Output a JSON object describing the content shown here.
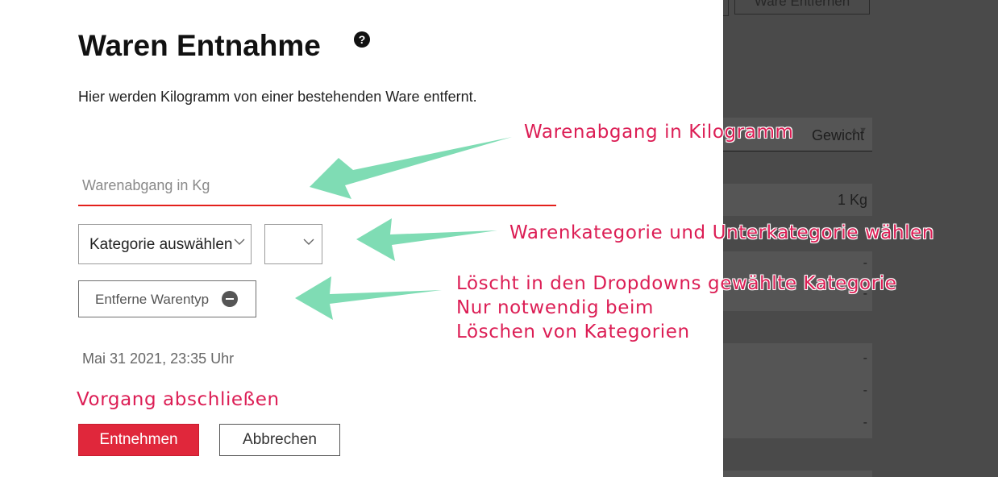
{
  "background": {
    "top_button_label": "Ware Entfernen",
    "select_text": "Gewicht",
    "rows": [
      {
        "value": "1 Kg"
      },
      {
        "value": "-"
      },
      {
        "value": "-"
      },
      {
        "value": "-"
      },
      {
        "value": "-"
      },
      {
        "value": "-"
      }
    ]
  },
  "modal": {
    "title": "Waren Entnahme",
    "help_icon": "question-circle-icon",
    "description": "Hier werden Kilogramm von einer bestehenden Ware entfernt.",
    "kg_input": {
      "value": "",
      "placeholder": "Warenabgang in Kg"
    },
    "category_select": {
      "selected": "Kategorie auswählen",
      "chevron_icon": "chevron-down-icon"
    },
    "subcategory_select": {
      "selected": "",
      "chevron_icon": "chevron-down-icon"
    },
    "remove_type_button": {
      "label": "Entferne Warentyp",
      "icon": "minus-circle-icon"
    },
    "datetime": "Mai 31 2021, 23:35 Uhr",
    "submit_label": "Entnehmen",
    "cancel_label": "Abbrechen"
  },
  "annotations": {
    "kg": "Warenabgang in Kilogramm",
    "category": "Warenkategorie und Unterkategorie wählen",
    "remove_line1": "Löscht in den Dropdowns gewählte Kategorie",
    "remove_line2": "Nur notwendig beim",
    "remove_line3": "Löschen von Kategorien",
    "finish": "Vorgang abschließen"
  },
  "colors": {
    "accent_red": "#e0273b",
    "input_underline": "#e3201b",
    "annotation_text": "#dc1e55",
    "annotation_arrow": "#7fdcb4",
    "backdrop": "#4a4a4a"
  }
}
